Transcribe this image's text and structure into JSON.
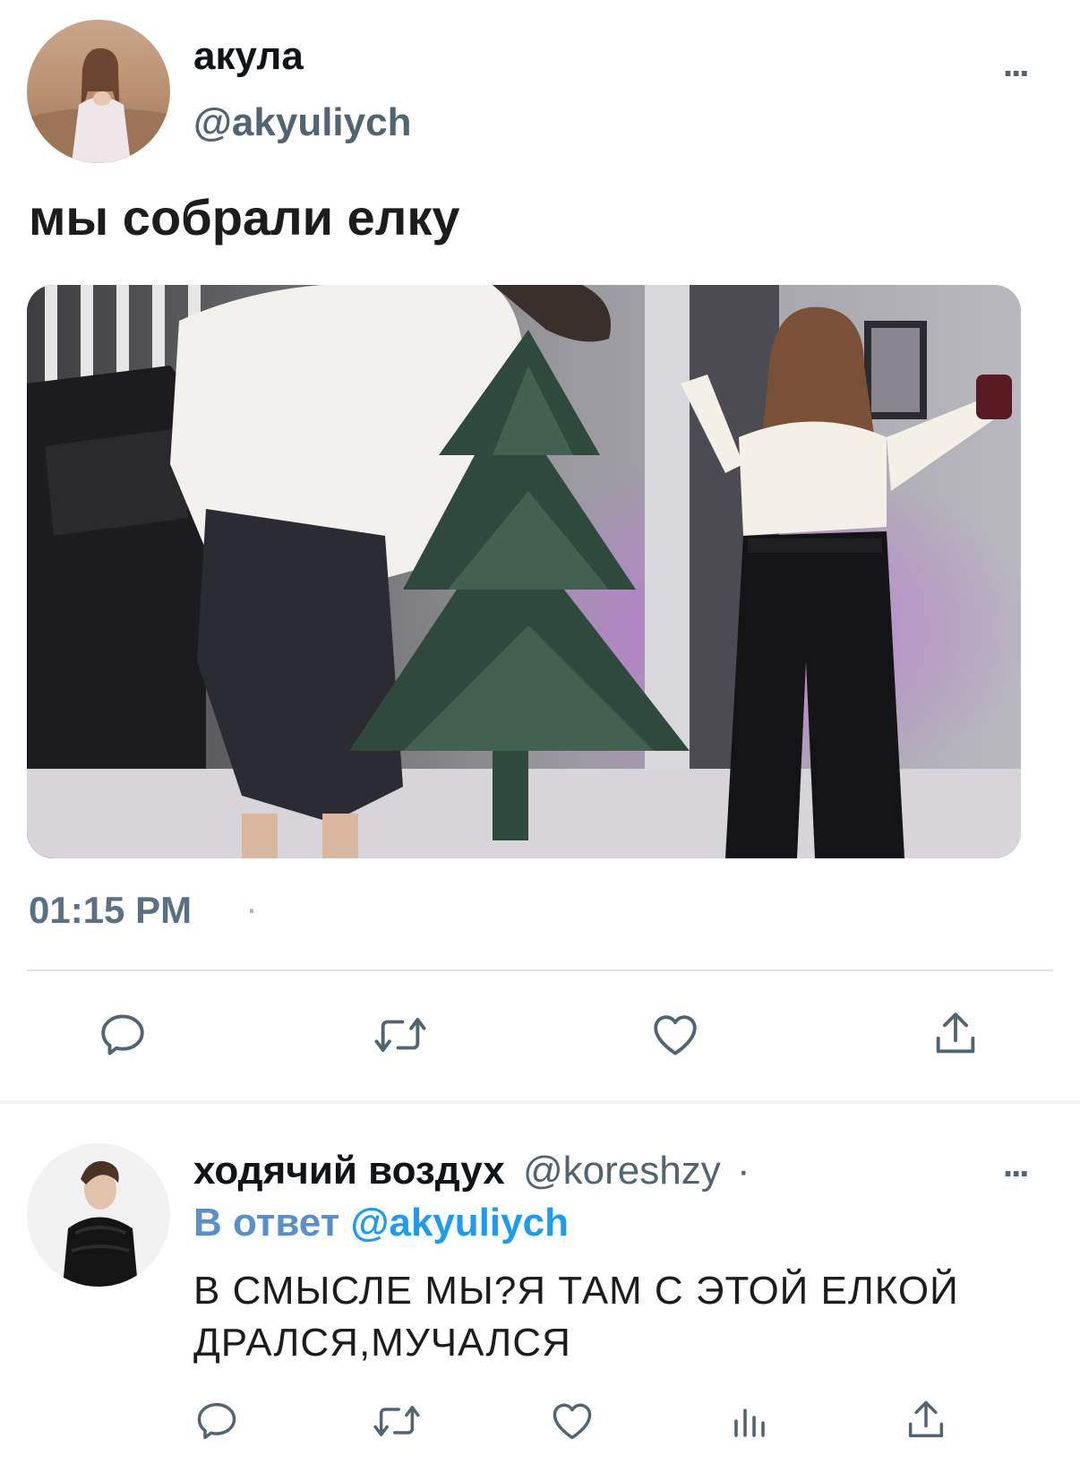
{
  "tweet": {
    "display_name": "акула",
    "handle": "@akyuliych",
    "text": "мы собрали елку",
    "time": "01:15 PM",
    "time_separator": "·",
    "more_label": "...",
    "actions": [
      "reply-icon",
      "retweet-icon",
      "like-icon",
      "share-icon"
    ]
  },
  "reply": {
    "display_name": "ходячий воздух",
    "handle": "@koreshzy",
    "separator": "·",
    "reply_to_prefix": "В ответ",
    "reply_to_handle": "@akyuliych",
    "text_line1": "В СМЫСЛЕ МЫ?Я ТАМ С ЭТОЙ ЕЛКОЙ",
    "text_line2": "ДРАЛСЯ,МУЧАЛСЯ",
    "more_label": "...",
    "actions": [
      "reply-icon",
      "retweet-icon",
      "like-icon",
      "analytics-icon",
      "share-icon"
    ]
  },
  "colors": {
    "text": "#0f1419",
    "secondary": "#536471",
    "link": "#1d9bf0",
    "divider": "#e1e4e8"
  }
}
